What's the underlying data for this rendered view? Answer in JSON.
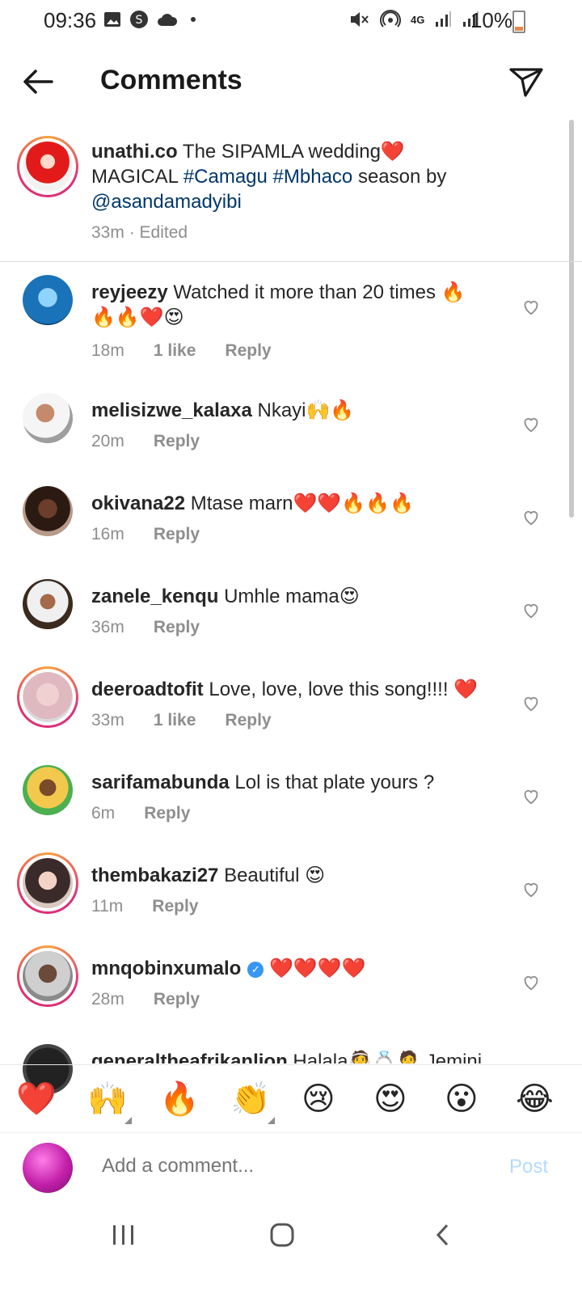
{
  "status_bar": {
    "time": "09:36",
    "battery": "10%",
    "network": "4G"
  },
  "header": {
    "title": "Comments"
  },
  "caption": {
    "username": "unathi.co",
    "text_before": " The SIPAMLA wedding❤️",
    "line2_start": "MAGICAL ",
    "hashtag1": "#Camagu",
    "space": " ",
    "hashtag2": "#Mbhaco",
    "line2_end": " season by",
    "mention": "@asandamadyibi",
    "time": "33m",
    "sep": " · ",
    "edited": "Edited"
  },
  "comments": [
    {
      "username": "reyjeezy",
      "text": " Watched it more than 20 times 🔥",
      "text2": "🔥🔥❤️😍",
      "time": "18m",
      "likes": "1 like",
      "reply": "Reply"
    },
    {
      "username": "melisizwe_kalaxa",
      "text": " Nkayi🙌🔥",
      "time": "20m",
      "reply": "Reply"
    },
    {
      "username": "okivana22",
      "text": " Mtase marn❤️❤️🔥🔥🔥",
      "time": "16m",
      "reply": "Reply"
    },
    {
      "username": "zanele_kenqu",
      "text": " Umhle mama😍",
      "time": "36m",
      "reply": "Reply"
    },
    {
      "username": "deeroadtofit",
      "text": " Love, love, love this song!!!! ❤️",
      "time": "33m",
      "likes": "1 like",
      "reply": "Reply"
    },
    {
      "username": "sarifamabunda",
      "text": " Lol is that plate yours ?",
      "time": "6m",
      "reply": "Reply"
    },
    {
      "username": "thembakazi27",
      "text": " Beautiful 😍",
      "time": "11m",
      "reply": "Reply"
    },
    {
      "username": "mnqobinxumalo",
      "text": " ❤️❤️❤️❤️",
      "time": "28m",
      "reply": "Reply"
    },
    {
      "username": "generaltheafrikanlion",
      "text": " Halala👰💍🤵 Jemini"
    }
  ],
  "emoji_bar": [
    "❤️",
    "🙌",
    "🔥",
    "👏",
    "😢",
    "😍",
    "😮",
    "😂"
  ],
  "composer": {
    "placeholder": "Add a comment...",
    "post": "Post"
  },
  "icons": {
    "back": "back-arrow-icon",
    "send": "direct-send-icon",
    "heart": "heart-outline-icon",
    "verified": "verified-badge-icon"
  },
  "colors": {
    "link": "#00376b",
    "muted": "#8e8e8e",
    "post_disabled": "#b3dbff",
    "verified": "#3897f0"
  }
}
